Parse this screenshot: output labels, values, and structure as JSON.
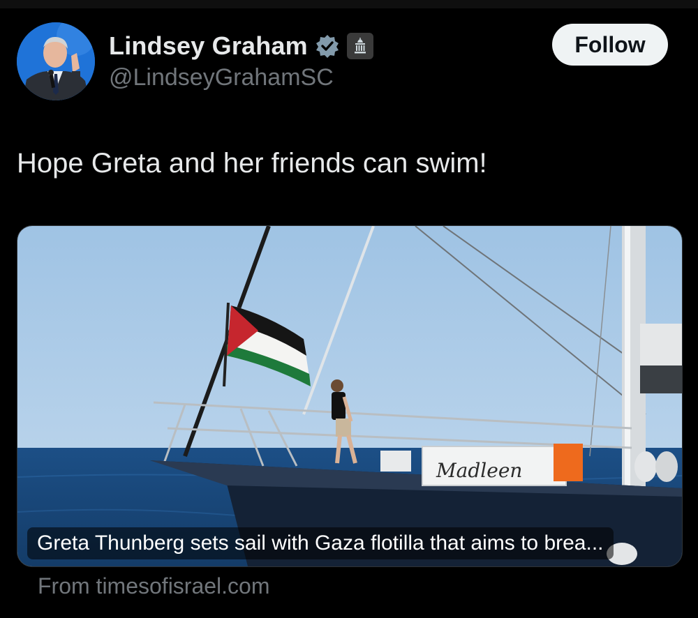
{
  "author": {
    "display_name": "Lindsey Graham",
    "handle": "@LindseyGrahamSC",
    "verified_icon": "verified-badge-icon",
    "affiliation_icon": "government-building-icon"
  },
  "actions": {
    "follow_label": "Follow"
  },
  "tweet": {
    "text": "Hope Greta and her friends can swim!"
  },
  "card": {
    "title": "Greta Thunberg sets sail with Gaza flotilla that aims to brea...",
    "source": "From timesofisrael.com",
    "boat_name": "Madleen"
  },
  "colors": {
    "background": "#000000",
    "text": "#e7e9ea",
    "muted": "#71767b",
    "follow_bg": "#eff3f4"
  }
}
